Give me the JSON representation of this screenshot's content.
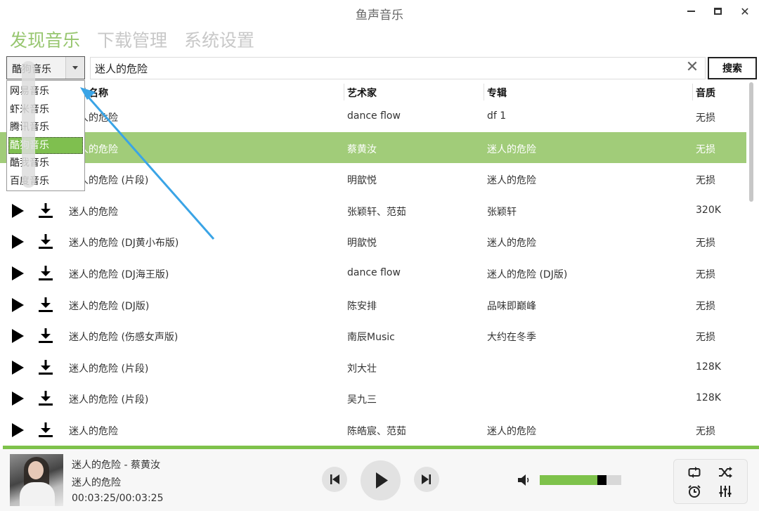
{
  "window": {
    "title": "鱼声音乐"
  },
  "tabs": [
    {
      "label": "发现音乐",
      "active": true
    },
    {
      "label": "下载管理",
      "active": false
    },
    {
      "label": "系统设置",
      "active": false
    }
  ],
  "search": {
    "source_selected": "酷狗音乐",
    "query": "迷人的危险",
    "button_label": "搜索"
  },
  "sources": [
    {
      "label": "网易音乐"
    },
    {
      "label": "虾米音乐"
    },
    {
      "label": "腾讯音乐"
    },
    {
      "label": "酷狗音乐",
      "selected": true
    },
    {
      "label": "酷我音乐"
    },
    {
      "label": "百度音乐"
    }
  ],
  "table": {
    "headers": {
      "song": "歌曲名称",
      "artist": "艺术家",
      "album": "专辑",
      "quality": "音质"
    },
    "rows": [
      {
        "song": "迷人的危险",
        "artist": "dance flow",
        "album": "df 1",
        "quality": "无损"
      },
      {
        "song": "迷人的危险",
        "artist": "蔡黄汝",
        "album": "迷人的危险",
        "quality": "无损",
        "selected": true
      },
      {
        "song": "迷人的危险 (片段)",
        "artist": "明歆悦",
        "album": "迷人的危险",
        "quality": "无损"
      },
      {
        "song": "迷人的危险",
        "artist": "张颖轩、范茹",
        "album": "张颖轩",
        "quality": "320K"
      },
      {
        "song": "迷人的危险 (DJ黄小布版)",
        "artist": "明歆悦",
        "album": "迷人的危险",
        "quality": "无损"
      },
      {
        "song": "迷人的危险 (DJ海王版)",
        "artist": "dance flow",
        "album": "迷人的危险 (DJ版)",
        "quality": "无损"
      },
      {
        "song": "迷人的危险 (DJ版)",
        "artist": "陈安排",
        "album": "品味即巅峰",
        "quality": "无损"
      },
      {
        "song": "迷人的危险 (伤感女声版)",
        "artist": "南辰Music",
        "album": "大约在冬季",
        "quality": "无损"
      },
      {
        "song": "迷人的危险 (片段)",
        "artist": "刘大壮",
        "album": "",
        "quality": "128K"
      },
      {
        "song": "迷人的危险 (片段)",
        "artist": "吴九三",
        "album": "",
        "quality": "128K"
      },
      {
        "song": "迷人的危险",
        "artist": "陈皓宸、范茹",
        "album": "迷人的危险",
        "quality": "无损"
      }
    ]
  },
  "player": {
    "title_line": "迷人的危险 - 蔡黄汝",
    "album_line": "迷人的危险",
    "time_line": "00:03:25/00:03:25",
    "volume_percent": 80
  },
  "colors": {
    "accent": "#7ec24b",
    "selected_row": "#a1cc79",
    "tab_active": "#97c66f",
    "tab_inactive": "#c8c8c8"
  },
  "icons": [
    "play-icon",
    "download-icon",
    "prev-icon",
    "next-icon",
    "volume-icon",
    "repeat-icon",
    "shuffle-icon",
    "alarm-icon",
    "equalizer-icon",
    "close-icon",
    "minimize-icon",
    "maximize-icon"
  ]
}
